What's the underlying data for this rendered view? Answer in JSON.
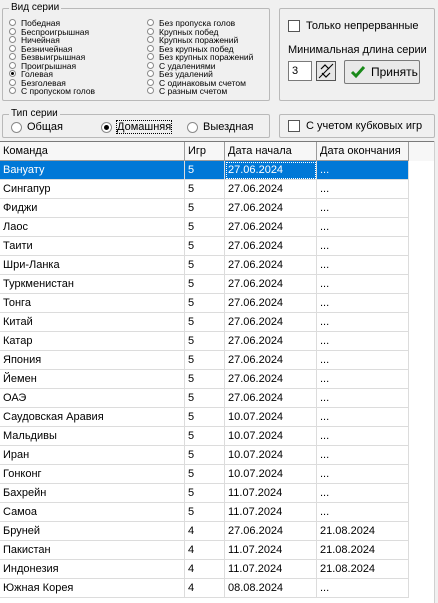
{
  "series_kind": {
    "title": "Вид серии",
    "left_options": [
      {
        "label": "Победная",
        "checked": false
      },
      {
        "label": "Беспроигрышная",
        "checked": false
      },
      {
        "label": "Ничейная",
        "checked": false
      },
      {
        "label": "Безничейная",
        "checked": false
      },
      {
        "label": "Безвыигрышная",
        "checked": false
      },
      {
        "label": "Проигрышная",
        "checked": false
      },
      {
        "label": "Голевая",
        "checked": true
      },
      {
        "label": "Безголевая",
        "checked": false
      },
      {
        "label": "С пропуском голов",
        "checked": false
      }
    ],
    "right_options": [
      {
        "label": "Без пропуска голов",
        "checked": false
      },
      {
        "label": "Крупных побед",
        "checked": false
      },
      {
        "label": "Крупных поражений",
        "checked": false
      },
      {
        "label": "Без крупных побед",
        "checked": false
      },
      {
        "label": "Без крупных поражений",
        "checked": false
      },
      {
        "label": "С удалениями",
        "checked": false
      },
      {
        "label": "Без удалений",
        "checked": false
      },
      {
        "label": "С одинаковым счетом",
        "checked": false
      },
      {
        "label": "С разным счетом",
        "checked": false
      }
    ]
  },
  "options": {
    "continuous_only_label": "Только непрерванные",
    "min_length_label": "Минимальная длина серии",
    "min_length_value": "3",
    "apply_label": "Принять",
    "cups_label": "С учетом кубковых игр"
  },
  "series_type": {
    "title": "Тип серии",
    "options": [
      {
        "label": "Общая",
        "checked": false
      },
      {
        "label": "Домашняя",
        "checked": true
      },
      {
        "label": "Выездная",
        "checked": false
      }
    ]
  },
  "table": {
    "columns": [
      "Команда",
      "Игр",
      "Дата начала",
      "Дата окончания"
    ],
    "rows": [
      [
        "Вануату",
        "5",
        "27.06.2024",
        "..."
      ],
      [
        "Сингапур",
        "5",
        "27.06.2024",
        "..."
      ],
      [
        "Фиджи",
        "5",
        "27.06.2024",
        "..."
      ],
      [
        "Лаос",
        "5",
        "27.06.2024",
        "..."
      ],
      [
        "Таити",
        "5",
        "27.06.2024",
        "..."
      ],
      [
        "Шри-Ланка",
        "5",
        "27.06.2024",
        "..."
      ],
      [
        "Туркменистан",
        "5",
        "27.06.2024",
        "..."
      ],
      [
        "Тонга",
        "5",
        "27.06.2024",
        "..."
      ],
      [
        "Китай",
        "5",
        "27.06.2024",
        "..."
      ],
      [
        "Катар",
        "5",
        "27.06.2024",
        "..."
      ],
      [
        "Япония",
        "5",
        "27.06.2024",
        "..."
      ],
      [
        "Йемен",
        "5",
        "27.06.2024",
        "..."
      ],
      [
        "ОАЭ",
        "5",
        "27.06.2024",
        "..."
      ],
      [
        "Саудовская Аравия",
        "5",
        "10.07.2024",
        "..."
      ],
      [
        "Мальдивы",
        "5",
        "10.07.2024",
        "..."
      ],
      [
        "Иран",
        "5",
        "10.07.2024",
        "..."
      ],
      [
        "Гонконг",
        "5",
        "10.07.2024",
        "..."
      ],
      [
        "Бахрейн",
        "5",
        "11.07.2024",
        "..."
      ],
      [
        "Самоа",
        "5",
        "11.07.2024",
        "..."
      ],
      [
        "Бруней",
        "4",
        "27.06.2024",
        "21.08.2024"
      ],
      [
        "Пакистан",
        "4",
        "11.07.2024",
        "21.08.2024"
      ],
      [
        "Индонезия",
        "4",
        "11.07.2024",
        "21.08.2024"
      ],
      [
        "Южная Корея",
        "4",
        "08.08.2024",
        "..."
      ]
    ],
    "selected_row": 0
  }
}
